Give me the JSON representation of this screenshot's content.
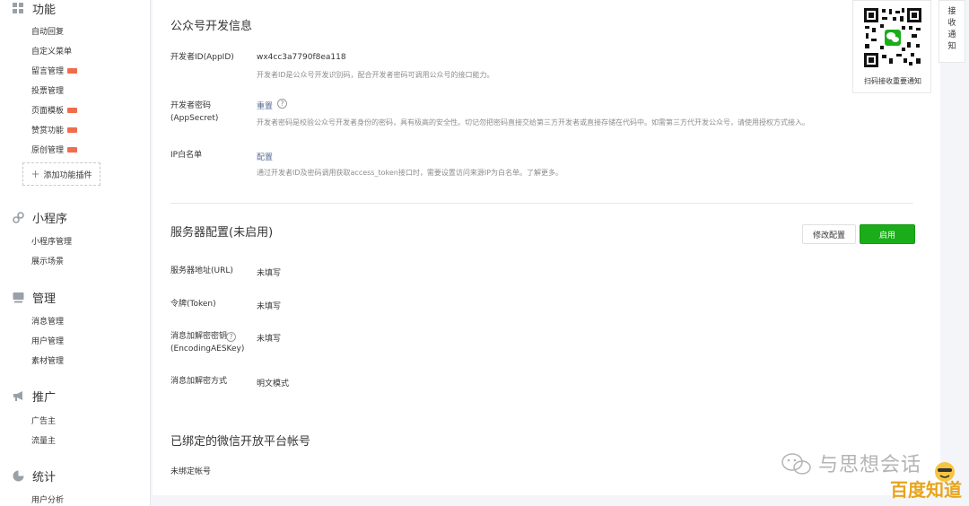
{
  "sidebar": {
    "sections": [
      {
        "title": "功能",
        "icon": "grid-icon",
        "items": [
          {
            "label": "自动回复",
            "new": false
          },
          {
            "label": "自定义菜单",
            "new": false
          },
          {
            "label": "留言管理",
            "new": true
          },
          {
            "label": "投票管理",
            "new": false
          },
          {
            "label": "页面模板",
            "new": true
          },
          {
            "label": "赞赏功能",
            "new": true
          },
          {
            "label": "原创管理",
            "new": true
          }
        ]
      },
      {
        "title": "小程序",
        "icon": "link-icon",
        "items": [
          {
            "label": "小程序管理"
          },
          {
            "label": "展示场景"
          }
        ]
      },
      {
        "title": "管理",
        "icon": "message-icon",
        "items": [
          {
            "label": "消息管理"
          },
          {
            "label": "用户管理"
          },
          {
            "label": "素材管理"
          }
        ]
      },
      {
        "title": "推广",
        "icon": "megaphone-icon",
        "items": [
          {
            "label": "广告主"
          },
          {
            "label": "流量主"
          }
        ]
      },
      {
        "title": "统计",
        "icon": "pie-chart-icon",
        "items": [
          {
            "label": "用户分析"
          }
        ]
      }
    ],
    "add_plugin": "添加功能插件"
  },
  "dev_info": {
    "title": "公众号开发信息",
    "appid_label": "开发者ID(AppID)",
    "appid_value": "wx4cc3a7790f8ea118",
    "appid_desc": "开发者ID是公众号开发识别码，配合开发者密码可调用公众号的接口能力。",
    "secret_label_1": "开发者密码",
    "secret_label_2": "(AppSecret)",
    "secret_action": "重置",
    "secret_desc": "开发者密码是校验公众号开发者身份的密码，具有极高的安全性。切记勿把密码直接交给第三方开发者或直接存储在代码中。如需第三方代开发公众号，请使用授权方式接入。",
    "ip_label": "IP白名单",
    "ip_action": "配置",
    "ip_desc": "通过开发者ID及密码调用获取access_token接口时，需要设置访问来源IP为白名单。了解更多。"
  },
  "server_config": {
    "title": "服务器配置(未启用)",
    "edit_button": "修改配置",
    "enable_button": "启用",
    "url_label": "服务器地址(URL)",
    "url_value": "未填写",
    "token_label": "令牌(Token)",
    "token_value": "未填写",
    "aes_label_1": "消息加解密密钥",
    "aes_label_2": "(EncodingAESKey)",
    "aes_value": "未填写",
    "mode_label": "消息加解密方式",
    "mode_value": "明文模式"
  },
  "open_platform": {
    "title": "已绑定的微信开放平台帐号",
    "status": "未绑定帐号"
  },
  "qr_card": {
    "caption": "扫码接收重要通知"
  },
  "side_tab": {
    "chars": [
      "接",
      "收",
      "通",
      "知"
    ]
  },
  "watermark": {
    "text": "与思想会话",
    "brand": "百度知道"
  },
  "colors": {
    "primary": "#1aad19",
    "link": "#576b95",
    "badge": "#f26b4a"
  }
}
